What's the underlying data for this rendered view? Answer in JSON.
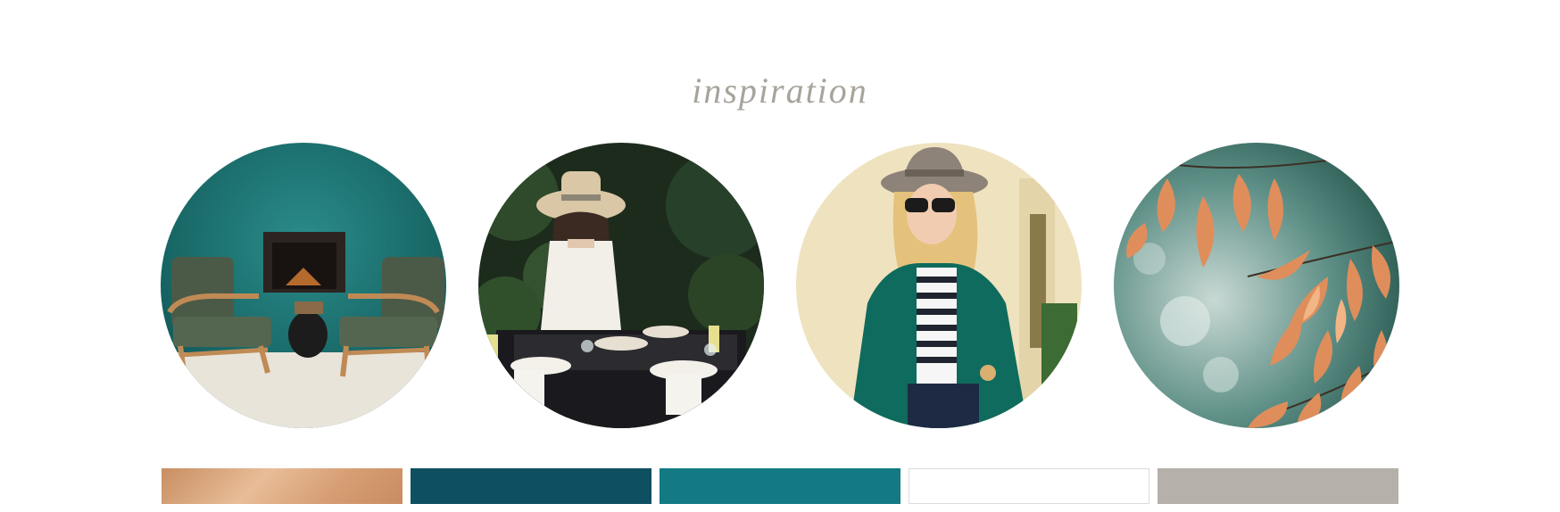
{
  "page": {
    "title": "inspiration"
  },
  "images": [
    {
      "subject": "teal-fireplace-armchairs"
    },
    {
      "subject": "woman-setting-table-outdoors"
    },
    {
      "subject": "woman-hat-green-blazer"
    },
    {
      "subject": "autumn-beech-leaves"
    }
  ],
  "swatches": [
    {
      "name": "copper",
      "color": "#d7a07b"
    },
    {
      "name": "deep-teal",
      "color": "#0e4f62"
    },
    {
      "name": "teal",
      "color": "#137a84"
    },
    {
      "name": "white",
      "color": "#ffffff"
    },
    {
      "name": "taupe",
      "color": "#b5b0aa"
    }
  ]
}
